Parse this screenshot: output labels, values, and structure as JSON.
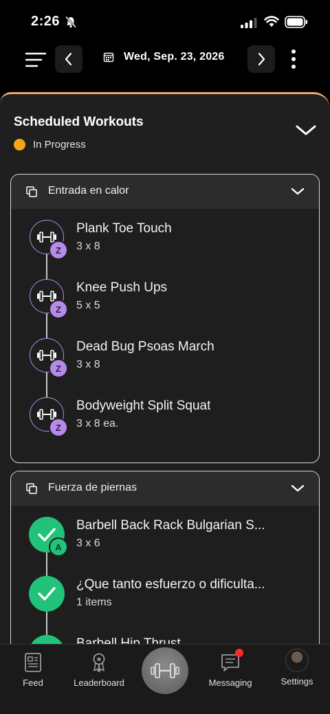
{
  "status_bar": {
    "time": "2:26"
  },
  "nav": {
    "date": "Wed, Sep. 23, 2026"
  },
  "panel": {
    "title": "Scheduled Workouts",
    "status": "In Progress",
    "status_color": "#f6a51b"
  },
  "groups": [
    {
      "title": "Entrada en calor",
      "exercises": [
        {
          "name": "Plank Toe Touch",
          "sets": "3 x 8",
          "badge": "Z",
          "done": false
        },
        {
          "name": "Knee Push Ups",
          "sets": "5 x 5",
          "badge": "Z",
          "done": false
        },
        {
          "name": "Dead Bug Psoas March",
          "sets": "3 x 8",
          "badge": "Z",
          "done": false
        },
        {
          "name": "Bodyweight Split Squat",
          "sets": "3 x 8 ea.",
          "badge": "Z",
          "done": false
        }
      ]
    },
    {
      "title": "Fuerza de piernas",
      "exercises": [
        {
          "name": "Barbell Back Rack Bulgarian S...",
          "sets": "3 x 6",
          "badge": "A",
          "done": true
        },
        {
          "name": "¿Que tanto esfuerzo o dificulta...",
          "sets": "1 items",
          "badge": "",
          "done": true
        },
        {
          "name": "Barbell Hip Thrust",
          "sets": "",
          "badge": "",
          "done": true
        }
      ]
    }
  ],
  "tabs": {
    "feed": "Feed",
    "leaderboard": "Leaderboard",
    "messaging": "Messaging",
    "settings": "Settings"
  },
  "colors": {
    "accent_done": "#21c27a",
    "accent_pending": "#b78be9",
    "panel_border": "#f2a66a"
  }
}
